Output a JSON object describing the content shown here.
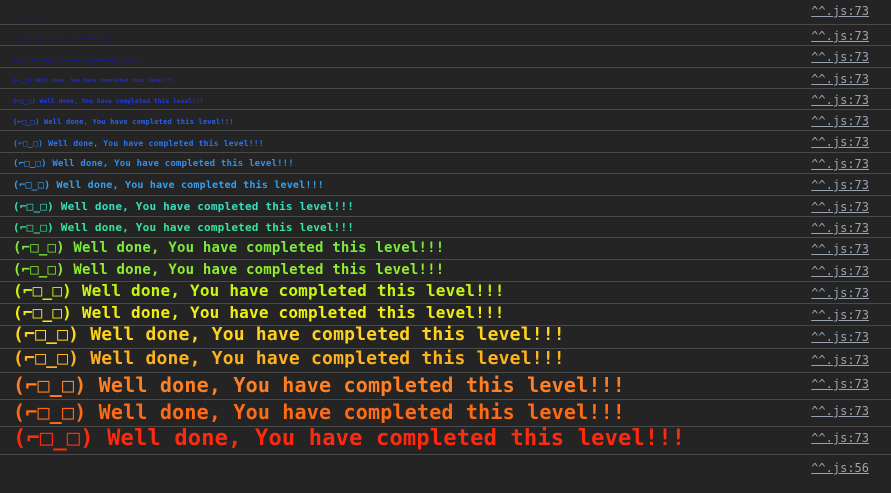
{
  "console": {
    "message_text": "(⌐□_□) Well done, You have completed this level!!!",
    "source_link": "^^.js:73",
    "final_source_link": "^^.js:56",
    "entries": [
      {
        "color": "#0c0cd6",
        "size": 1
      },
      {
        "color": "#1212dc",
        "size": 3
      },
      {
        "color": "#1313dd",
        "size": 4
      },
      {
        "color": "#1f2aea",
        "size": 5
      },
      {
        "color": "#2138ee",
        "size": 6
      },
      {
        "color": "#2860ee",
        "size": 7
      },
      {
        "color": "#2d74ef",
        "size": 8
      },
      {
        "color": "#328ff0",
        "size": 9
      },
      {
        "color": "#33a1f2",
        "size": 10
      },
      {
        "color": "#33e0bf",
        "size": 11
      },
      {
        "color": "#34e69b",
        "size": 11
      },
      {
        "color": "#7cea3a",
        "size": 14
      },
      {
        "color": "#8fee2e",
        "size": 14
      },
      {
        "color": "#c8f510",
        "size": 16
      },
      {
        "color": "#f2ee12",
        "size": 16
      },
      {
        "color": "#ffd21e",
        "size": 18
      },
      {
        "color": "#ffb21e",
        "size": 18
      },
      {
        "color": "#ff7f22",
        "size": 20
      },
      {
        "color": "#ff6a14",
        "size": 20
      },
      {
        "color": "#ff2a0e",
        "size": 22
      }
    ]
  }
}
